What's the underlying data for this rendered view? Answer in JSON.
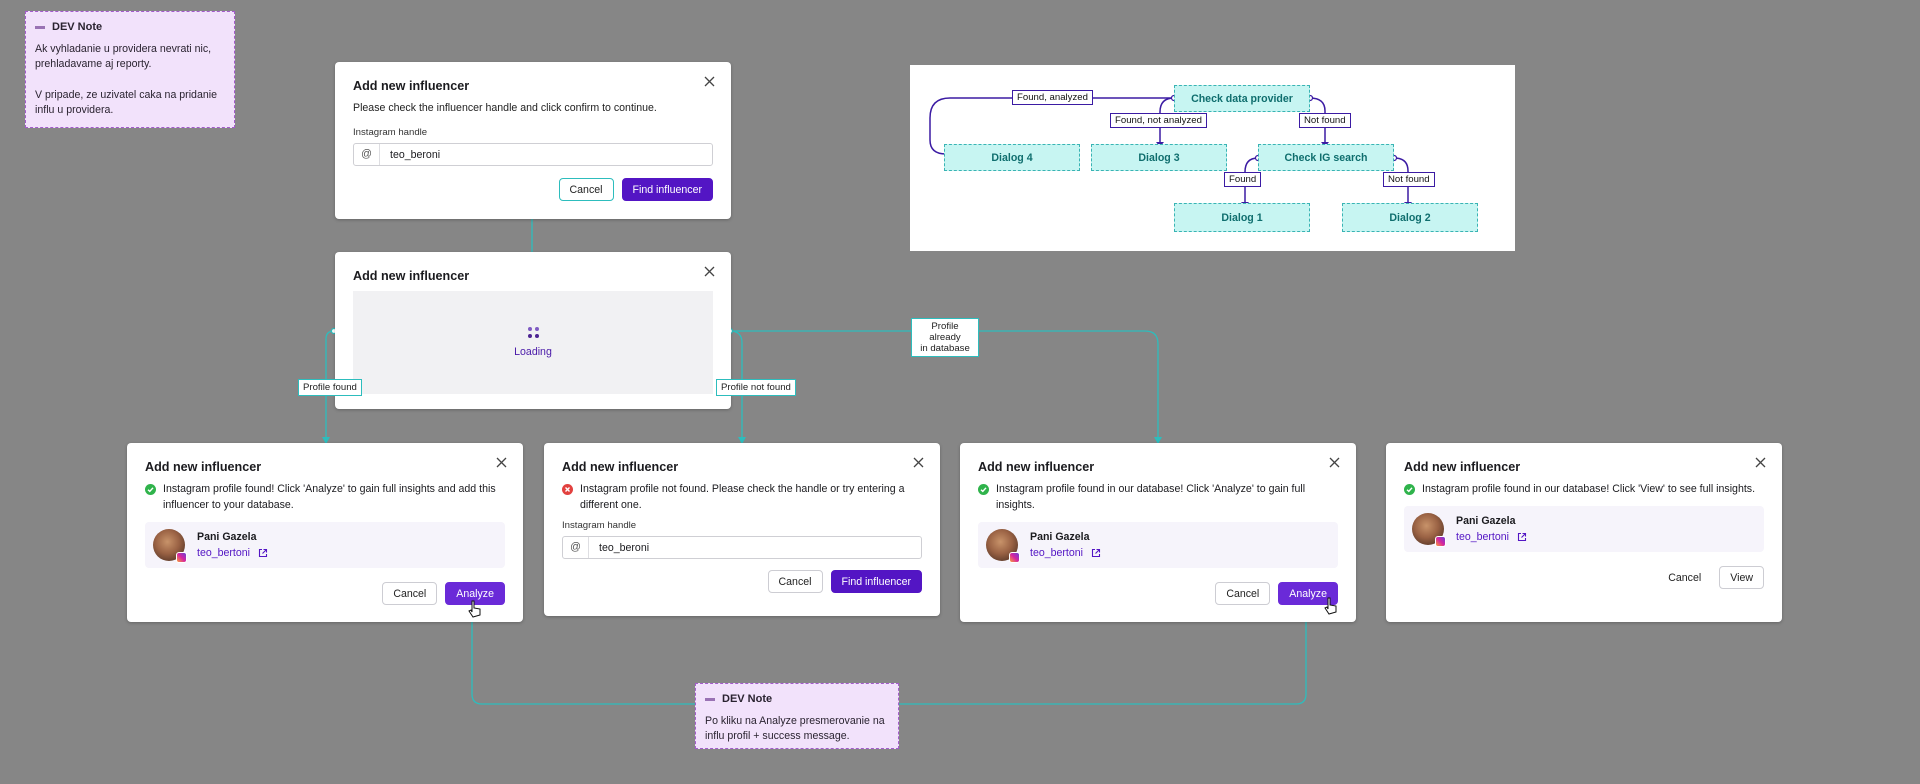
{
  "notes": {
    "top": {
      "title": "DEV Note",
      "p1": "Ak vyhladanie u providera nevrati nic, prehladavame aj reporty.",
      "p2": "V pripade, ze uzivatel caka na pridanie influ u providera."
    },
    "bottom": {
      "title": "DEV Note",
      "p1": "Po kliku na Analyze presmerovanie na influ profil + success message."
    }
  },
  "dialog_title": "Add new influencer",
  "dialog_initial": {
    "desc": "Please check the influencer handle and click confirm to continue.",
    "field_label": "Instagram handle",
    "prefix": "@",
    "value": "teo_beroni",
    "cancel": "Cancel",
    "find": "Find influencer"
  },
  "dialog_loading": {
    "text": "Loading"
  },
  "dialog_found": {
    "message": "Instagram profile found! Click 'Analyze' to gain full insights and add this influencer to your database.",
    "name": "Pani Gazela",
    "handle": "teo_bertoni",
    "cancel": "Cancel",
    "analyze": "Analyze"
  },
  "dialog_not_found": {
    "message": "Instagram profile not found. Please check the handle or try entering a different one.",
    "field_label": "Instagram handle",
    "prefix": "@",
    "value": "teo_beroni",
    "cancel": "Cancel",
    "find": "Find influencer"
  },
  "dialog_in_db_analyze": {
    "message": "Instagram profile found in our database! Click 'Analyze' to gain full insights.",
    "name": "Pani Gazela",
    "handle": "teo_bertoni",
    "cancel": "Cancel",
    "analyze": "Analyze"
  },
  "dialog_in_db_view": {
    "message": "Instagram profile found in our database! Click 'View' to see full insights.",
    "name": "Pani Gazela",
    "handle": "teo_bertoni",
    "cancel": "Cancel",
    "view": "View"
  },
  "connectors": {
    "profile_found": "Profile found",
    "profile_not_found": "Profile not found",
    "already_line1": "Profile already",
    "already_line2": "in database"
  },
  "flow": {
    "check_data_provider": "Check data provider",
    "dialog4": "Dialog 4",
    "dialog3": "Dialog 3",
    "check_ig_search": "Check IG search",
    "dialog1": "Dialog 1",
    "dialog2": "Dialog 2",
    "found_analyzed": "Found, analyzed",
    "found_not_analyzed": "Found, not analyzed",
    "not_found_1": "Not found",
    "found": "Found",
    "not_found_2": "Not found"
  },
  "colors": {
    "background": "#868686",
    "primary": "#5315c4",
    "connector": "#2dbdbd",
    "flow_line": "#3b1ba3",
    "note_bg": "#f2e2fb",
    "success": "#2fb34b",
    "error": "#e2413f"
  }
}
